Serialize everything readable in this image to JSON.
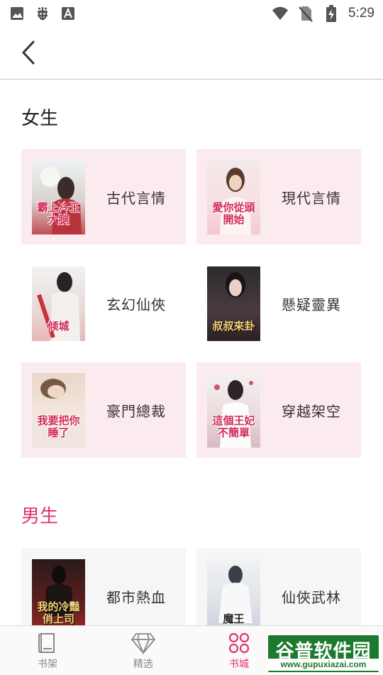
{
  "status_bar": {
    "time": "5:29",
    "left_icons": [
      "image-icon",
      "bug-icon",
      "font-a-icon"
    ],
    "right_icons": [
      "wifi-icon",
      "no-sim-icon",
      "battery-charging-icon"
    ]
  },
  "top_bar": {
    "back_icon": "chevron-left-icon"
  },
  "sections": {
    "female": {
      "title": "女生",
      "items": [
        {
          "label": "古代言情",
          "cover_text": "霸上冷王大腿"
        },
        {
          "label": "現代言情",
          "cover_text": "愛你從頭開始"
        },
        {
          "label": "玄幻仙俠",
          "cover_text": "倾城"
        },
        {
          "label": "懸疑靈異",
          "cover_text": "叔叔來卦"
        },
        {
          "label": "豪門總裁",
          "cover_text": "我要把你睡了"
        },
        {
          "label": "穿越架空",
          "cover_text": "這個王妃不簡單"
        }
      ]
    },
    "male": {
      "title": "男生",
      "items": [
        {
          "label": "都市熱血",
          "cover_text": "我的冷豔俏上司"
        },
        {
          "label": "仙俠武林",
          "cover_text": "魔王"
        }
      ]
    }
  },
  "bottom_nav": {
    "items": [
      {
        "label": "书架",
        "icon": "book-icon"
      },
      {
        "label": "精选",
        "icon": "diamond-icon"
      },
      {
        "label": "书城",
        "icon": "grid-icon",
        "active": true
      }
    ]
  },
  "watermark": {
    "title": "谷普软件园",
    "url": "www.gupuxiazai.com"
  },
  "colors": {
    "accent": "#e0336b",
    "female_card_bg": "#fcebee",
    "male_card_bg": "#f6f6f6",
    "watermark_green": "#1c7a2e"
  }
}
